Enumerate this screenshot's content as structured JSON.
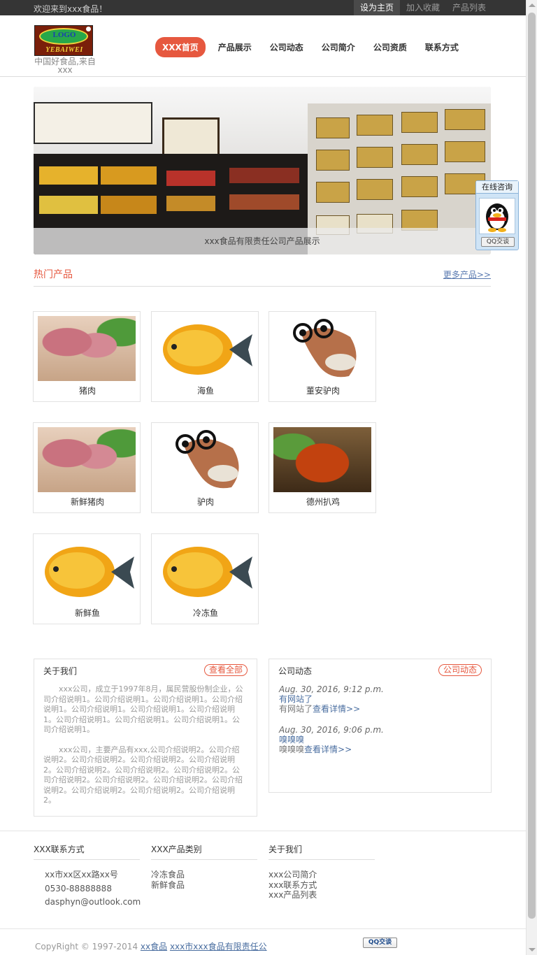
{
  "topbar": {
    "welcome": "欢迎来到xxx食品！",
    "links": [
      "设为主页",
      "加入收藏",
      "产品列表"
    ]
  },
  "header": {
    "logo_text": "LOGO",
    "logo_sub": "YEBAIWEI",
    "slogan": "中国好食品,来自xxx",
    "nav": [
      "XXX首页",
      "产品展示",
      "公司动态",
      "公司简介",
      "公司资质",
      "联系方式"
    ]
  },
  "banner": {
    "caption": "xxx食品有限责任公司产品展示"
  },
  "qq_float": {
    "title": "在线咨询",
    "button": "QQ交谈"
  },
  "hot": {
    "title": "热门产品",
    "more": "更多产品>>",
    "products": [
      {
        "name": "猪肉",
        "image": "pork"
      },
      {
        "name": "海鱼",
        "image": "fish"
      },
      {
        "name": "董安驴肉",
        "image": "donkey"
      },
      {
        "name": "新鲜猪肉",
        "image": "pork"
      },
      {
        "name": "驴肉",
        "image": "donkey"
      },
      {
        "name": "德州扒鸡",
        "image": "duck"
      },
      {
        "name": "新鲜鱼",
        "image": "fish"
      },
      {
        "name": "冷冻鱼",
        "image": "fish"
      }
    ]
  },
  "about": {
    "title": "关于我们",
    "more": "查看全部",
    "para1": "xxx公司，成立于1997年8月，属民营股份制企业，公司介绍说明1。公司介绍说明1。公司介绍说明1。公司介绍说明1。公司介绍说明1。公司介绍说明1。公司介绍说明1。公司介绍说明1。公司介绍说明1。公司介绍说明1。公司介绍说明1。",
    "para2": "xxx公司，主要产品有xxx,公司介绍说明2。公司介绍说明2。公司介绍说明2。公司介绍说明2。公司介绍说明2。公司介绍说明2。公司介绍说明2。公司介绍说明2。公司介绍说明2。公司介绍说明2。公司介绍说明2。公司介绍说明2。公司介绍说明2。公司介绍说明2。公司介绍说明2。"
  },
  "news": {
    "title": "公司动态",
    "more": "公司动态",
    "items": [
      {
        "date": "Aug. 30, 2016, 9:12 p.m.",
        "headline": "有网站了",
        "summary": "有网站了",
        "link": "查看详情>>"
      },
      {
        "date": "Aug. 30, 2016, 9:06 p.m.",
        "headline": "嗅嗅嗅",
        "summary": "嗅嗅嗅",
        "link": "查看详情>>"
      }
    ]
  },
  "footer": {
    "contact": {
      "title": "XXX联系方式",
      "lines": [
        "xx市xx区xx路xx号",
        "0530-88888888",
        "dasphyn@outlook.com"
      ]
    },
    "categories": {
      "title": "XXX产品类别",
      "lines": [
        "冷冻食品",
        "新鲜食品"
      ]
    },
    "aboutus": {
      "title": "关于我们",
      "lines": [
        "xxx公司简介",
        "xxx联系方式",
        "xxx产品列表"
      ]
    },
    "copyright_prefix": "CopyRight © 1997-2014",
    "copyright_link1": "xx食品",
    "copyright_link2": "xxx市xxx食品有限责任公",
    "qq_badge": "QQ交谈"
  },
  "colors": {
    "accent": "#e6583f",
    "link": "#4a6ea0",
    "topbar": "#353535"
  }
}
